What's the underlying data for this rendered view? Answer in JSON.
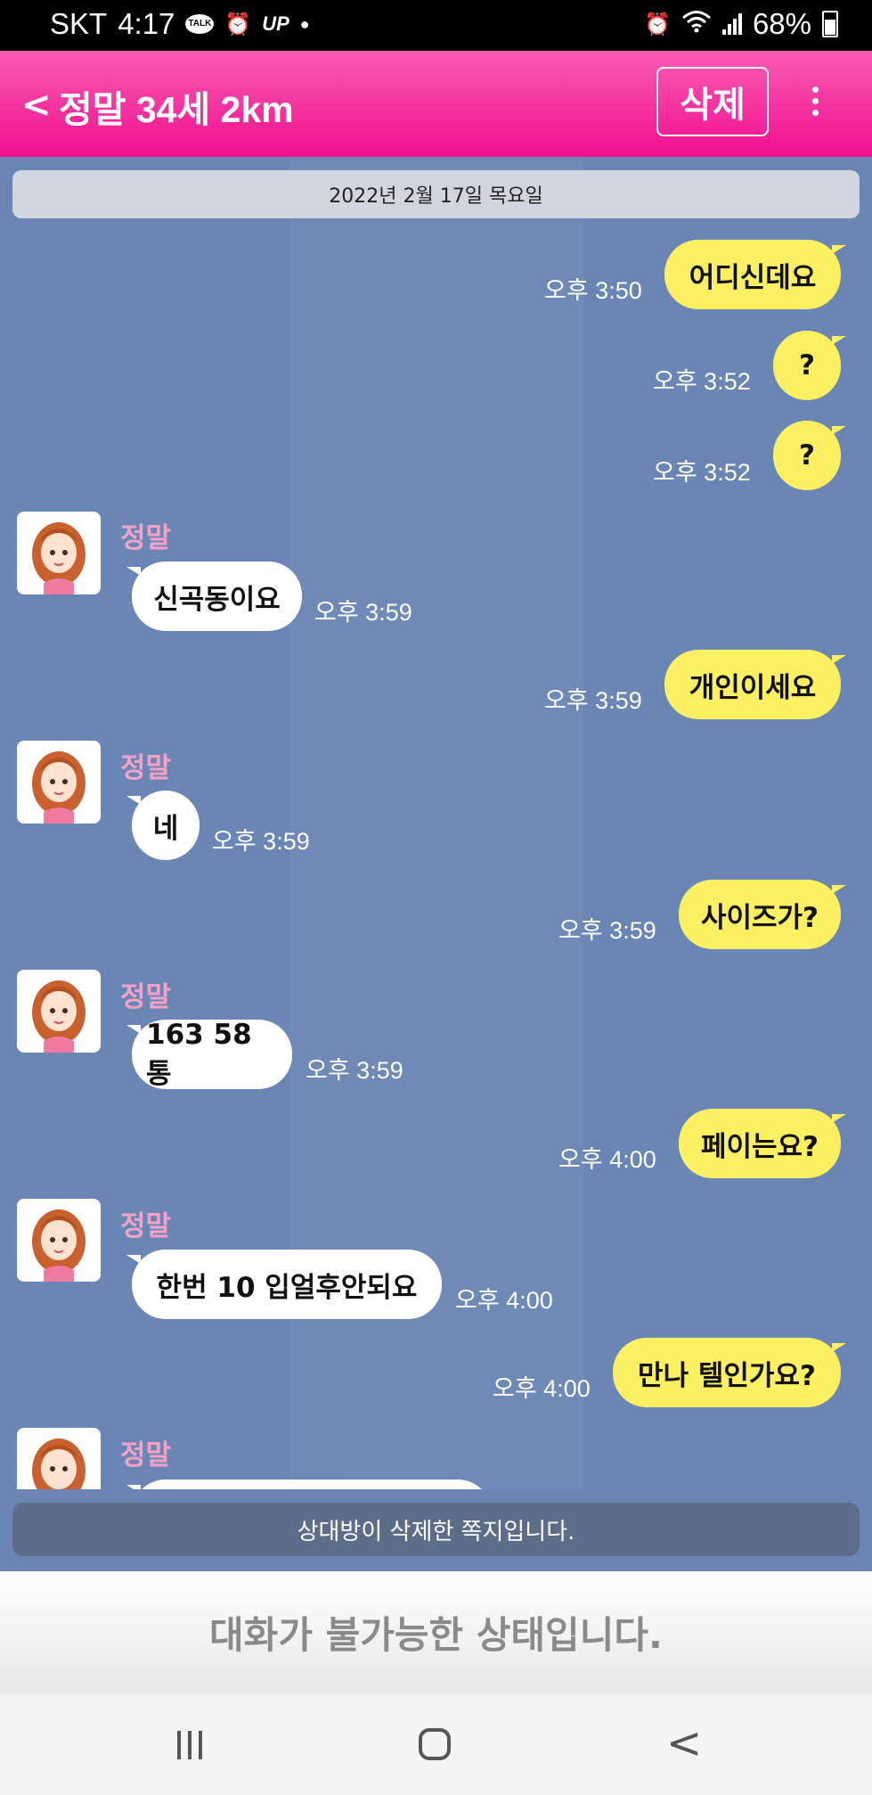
{
  "status_bar": {
    "carrier": "SKT",
    "time": "4:17",
    "talk_badge": "TALK",
    "up_badge": "UP",
    "battery_percent": "68%"
  },
  "header": {
    "back_icon": "chevron-left",
    "title": "정말 34세 2km",
    "delete_label": "삭제",
    "more_icon": "vertical-dots"
  },
  "chat": {
    "date": "2022년 2월 17일 목요일",
    "sender_name": "정말",
    "messages": [
      {
        "from": "me",
        "text": "어디신데요",
        "time": "오후 3:50"
      },
      {
        "from": "me",
        "text": "?",
        "time": "오후 3:52"
      },
      {
        "from": "me",
        "text": "?",
        "time": "오후 3:52"
      },
      {
        "from": "them",
        "text": "신곡동이요",
        "time": "오후 3:59"
      },
      {
        "from": "me",
        "text": "개인이세요",
        "time": "오후 3:59"
      },
      {
        "from": "them",
        "text": "네",
        "time": "오후 3:59"
      },
      {
        "from": "me",
        "text": "사이즈가?",
        "time": "오후 3:59"
      },
      {
        "from": "them",
        "text": "163 58 통",
        "time": "오후 3:59"
      },
      {
        "from": "me",
        "text": "페이는요?",
        "time": "오후 4:00"
      },
      {
        "from": "them",
        "text": "한번 10 입얼후안되요",
        "time": "오후 4:00"
      },
      {
        "from": "me",
        "text": "만나 텔인가요?",
        "time": "오후 4:00"
      }
    ]
  },
  "deleted_notice": "상대방이 삭제한 쪽지입니다.",
  "disabled_notice": "대화가 불가능한 상태입니다.",
  "colors": {
    "header_pink": "#f10f8e",
    "chat_bg": "#6a86b4",
    "my_bubble": "#fbef62",
    "their_bubble": "#ffffff",
    "sender_name": "#f4a2c8"
  },
  "nav_icons": [
    "recent-apps-icon",
    "home-icon",
    "back-icon"
  ]
}
